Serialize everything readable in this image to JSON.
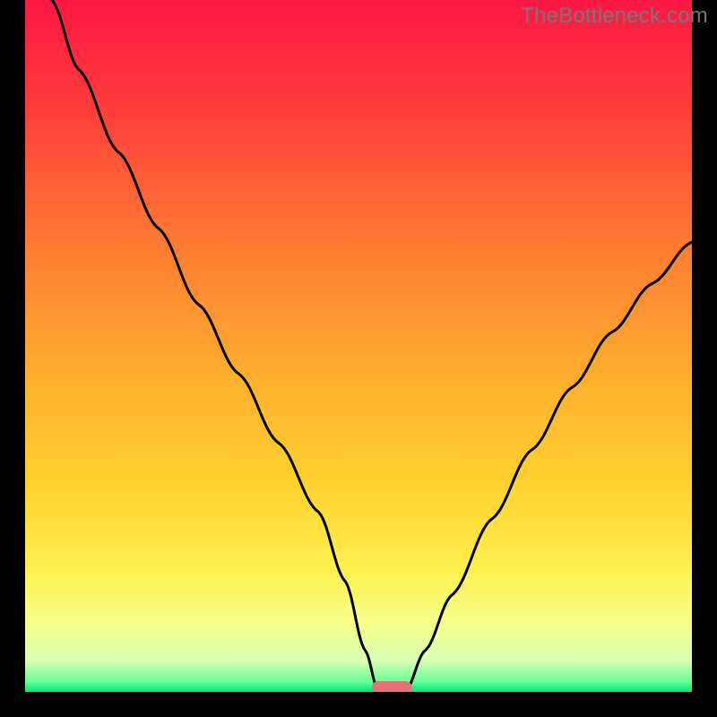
{
  "watermark": "TheBottleneck.com",
  "chart_data": {
    "type": "line",
    "title": "",
    "xlabel": "",
    "ylabel": "",
    "xlim": [
      0,
      100
    ],
    "ylim": [
      0,
      100
    ],
    "grid": false,
    "legend": false,
    "background_gradient": {
      "stops": [
        {
          "offset": 0.0,
          "color": "#ff1744"
        },
        {
          "offset": 0.15,
          "color": "#ff3b3b"
        },
        {
          "offset": 0.35,
          "color": "#ff7a33"
        },
        {
          "offset": 0.55,
          "color": "#ffb02e"
        },
        {
          "offset": 0.7,
          "color": "#ffd22e"
        },
        {
          "offset": 0.82,
          "color": "#fff04d"
        },
        {
          "offset": 0.9,
          "color": "#f7ff8a"
        },
        {
          "offset": 0.955,
          "color": "#d9ffb3"
        },
        {
          "offset": 0.985,
          "color": "#66ff99"
        },
        {
          "offset": 1.0,
          "color": "#00e676"
        }
      ]
    },
    "series": [
      {
        "name": "left-branch",
        "x": [
          4,
          8,
          14,
          20,
          26,
          32,
          38,
          44,
          48,
          51,
          53
        ],
        "y": [
          100,
          90,
          78,
          67,
          56,
          46,
          36,
          26,
          16,
          6,
          0
        ]
      },
      {
        "name": "right-branch",
        "x": [
          57,
          60,
          64,
          70,
          76,
          82,
          88,
          94,
          100
        ],
        "y": [
          0,
          6,
          14,
          25,
          35,
          44,
          52,
          59,
          65
        ]
      }
    ],
    "marker": {
      "name": "optimum-marker",
      "x": 55,
      "y": 0,
      "width": 6,
      "color": "#e57373"
    },
    "frame": {
      "left": true,
      "right": true,
      "bottom": true,
      "top": false,
      "thickness": 28,
      "color": "#000000"
    }
  }
}
